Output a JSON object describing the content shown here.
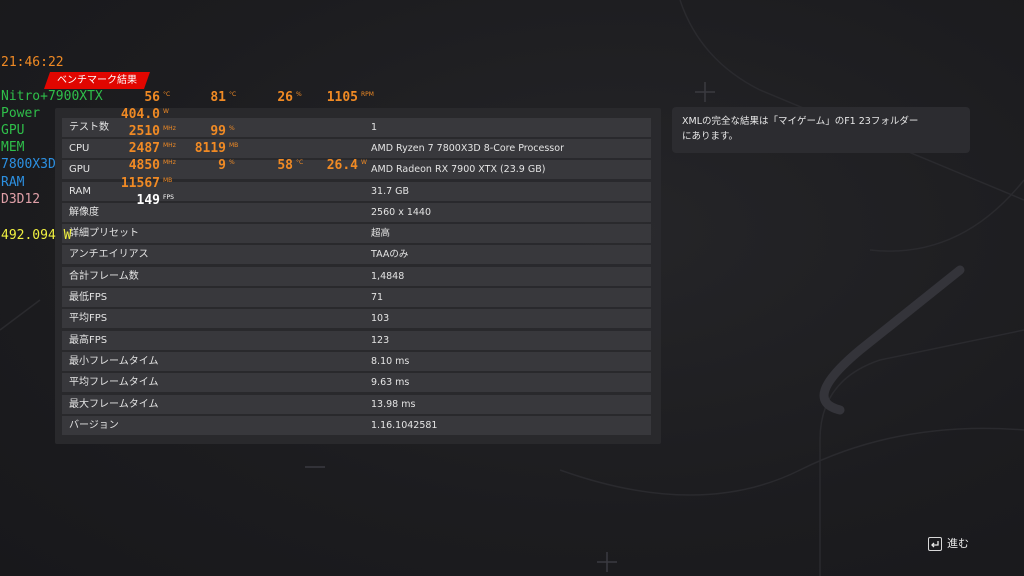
{
  "header": {
    "badge": "ベンチマーク結果"
  },
  "results": [
    {
      "label": "テスト数",
      "value": "1"
    },
    {
      "label": "CPU",
      "value": "AMD Ryzen 7 7800X3D 8-Core Processor"
    },
    {
      "label": "GPU",
      "value": "AMD Radeon RX 7900 XTX (23.9 GB)"
    },
    {
      "label": "RAM",
      "value": "31.7 GB"
    },
    {
      "label": "解像度",
      "value": "2560 x 1440"
    },
    {
      "label": "詳細プリセット",
      "value": "超高"
    },
    {
      "label": "アンチエイリアス",
      "value": "TAAのみ"
    },
    {
      "label": "合計フレーム数",
      "value": "1,4848"
    },
    {
      "label": "最低FPS",
      "value": "71"
    },
    {
      "label": "平均FPS",
      "value": "103"
    },
    {
      "label": "最高FPS",
      "value": "123"
    },
    {
      "label": "最小フレームタイム",
      "value": "8.10 ms"
    },
    {
      "label": "平均フレームタイム",
      "value": "9.63 ms"
    },
    {
      "label": "最大フレームタイム",
      "value": "13.98 ms"
    },
    {
      "label": "バージョン",
      "value": "1.16.1042581"
    }
  ],
  "info": {
    "line1": "XMLの完全な結果は「マイゲーム」のF1 23フォルダー",
    "line2": "にあります。"
  },
  "footer": {
    "next_label": "進む",
    "next_key_icon": "enter-key-icon"
  },
  "osd": {
    "time": "21:46:22",
    "rows": [
      {
        "label": "Nitro+7900XTX",
        "color": "#2fbf4a",
        "cells": [
          {
            "value": "56",
            "unit": "°C"
          },
          {
            "value": "81",
            "unit": "°C"
          },
          {
            "value": "26",
            "unit": "%"
          },
          {
            "value": "1105",
            "unit": "RPM"
          }
        ]
      },
      {
        "label": "Power",
        "color": "#2fbf4a",
        "cells": [
          {
            "value": "404.0",
            "unit": "W"
          }
        ]
      },
      {
        "label": "GPU",
        "color": "#2fbf4a",
        "cells": [
          {
            "value": "2510",
            "unit": "MHz"
          },
          {
            "value": "99",
            "unit": "%"
          }
        ]
      },
      {
        "label": "MEM",
        "color": "#2fbf4a",
        "cells": [
          {
            "value": "2487",
            "unit": "MHz"
          },
          {
            "value": "8119",
            "unit": "MB"
          }
        ]
      },
      {
        "label": "7800X3D",
        "color": "#2c8fe0",
        "cells": [
          {
            "value": "4850",
            "unit": "MHz"
          },
          {
            "value": "9",
            "unit": "%"
          },
          {
            "value": "58",
            "unit": "°C"
          },
          {
            "value": "26.4",
            "unit": "W"
          }
        ]
      },
      {
        "label": "RAM",
        "color": "#2c8fe0",
        "cells": [
          {
            "value": "11567",
            "unit": "MB"
          }
        ]
      },
      {
        "label": "D3D12",
        "color": "#e0a0a8",
        "cells": [
          {
            "value": "149",
            "unit": "FPS"
          }
        ]
      }
    ],
    "total_power": "492.094 W",
    "total_power_color": "#f0f040",
    "value_color": "#f08a24"
  }
}
